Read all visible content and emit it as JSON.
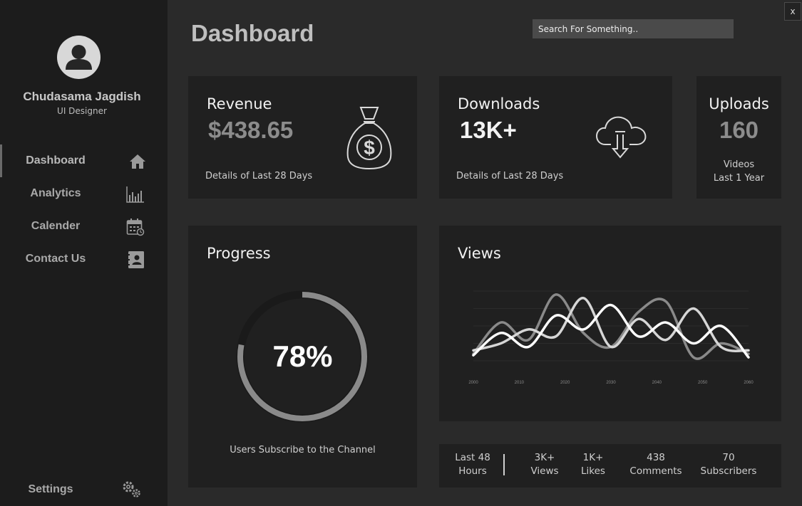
{
  "user": {
    "name": "Chudasama Jagdish",
    "role": "UI Designer"
  },
  "nav": [
    {
      "label": "Dashboard",
      "icon": "home-icon",
      "active": true
    },
    {
      "label": "Analytics",
      "icon": "bar-chart-icon",
      "active": false
    },
    {
      "label": "Calender",
      "icon": "calendar-icon",
      "active": false
    },
    {
      "label": "Contact Us",
      "icon": "contact-book-icon",
      "active": false
    }
  ],
  "settings": {
    "label": "Settings",
    "icon": "gears-icon"
  },
  "header": {
    "title": "Dashboard",
    "search_placeholder": "Search For Something..",
    "close_label": "x"
  },
  "revenue": {
    "title": "Revenue",
    "value": "$438.65",
    "note": "Details of Last 28 Days",
    "icon": "money-bag-icon"
  },
  "downloads": {
    "title": "Downloads",
    "value": "13K+",
    "note": "Details of Last 28 Days",
    "icon": "cloud-download-icon"
  },
  "uploads": {
    "title": "Uploads",
    "value": "160",
    "note_line1": "Videos",
    "note_line2": "Last 1 Year"
  },
  "progress": {
    "title": "Progress",
    "percent_label": "78%",
    "percent": 78,
    "caption": "Users Subscribe to the Channel"
  },
  "views": {
    "title": "Views"
  },
  "chart_data": {
    "type": "line",
    "x": [
      2000,
      2010,
      2020,
      2030,
      2040,
      2050,
      2060
    ],
    "x_tick_labels": [
      "2000",
      "2010",
      "2020",
      "2030",
      "2040",
      "2050",
      "2060"
    ],
    "grid": true,
    "series": [
      {
        "color": "#8a8a8a",
        "values": [
          0.1,
          0.55,
          0.3,
          0.95,
          0.4,
          0.2,
          0.7,
          0.85,
          0.05,
          0.25,
          0.1
        ]
      },
      {
        "color": "#d6d6d6",
        "values": [
          0.15,
          0.25,
          0.45,
          0.35,
          0.9,
          0.2,
          0.6,
          0.3,
          0.75,
          0.2,
          0.15
        ]
      },
      {
        "color": "#ffffff",
        "values": [
          0.08,
          0.4,
          0.2,
          0.65,
          0.45,
          0.8,
          0.35,
          0.55,
          0.25,
          0.5,
          0.05
        ]
      }
    ]
  },
  "stats": {
    "period_line1": "Last 48",
    "period_line2": "Hours",
    "items": [
      {
        "value": "3K+",
        "label": "Views"
      },
      {
        "value": "1K+",
        "label": "Likes"
      },
      {
        "value": "438",
        "label": "Comments"
      },
      {
        "value": "70",
        "label": "Subscribers"
      }
    ]
  }
}
